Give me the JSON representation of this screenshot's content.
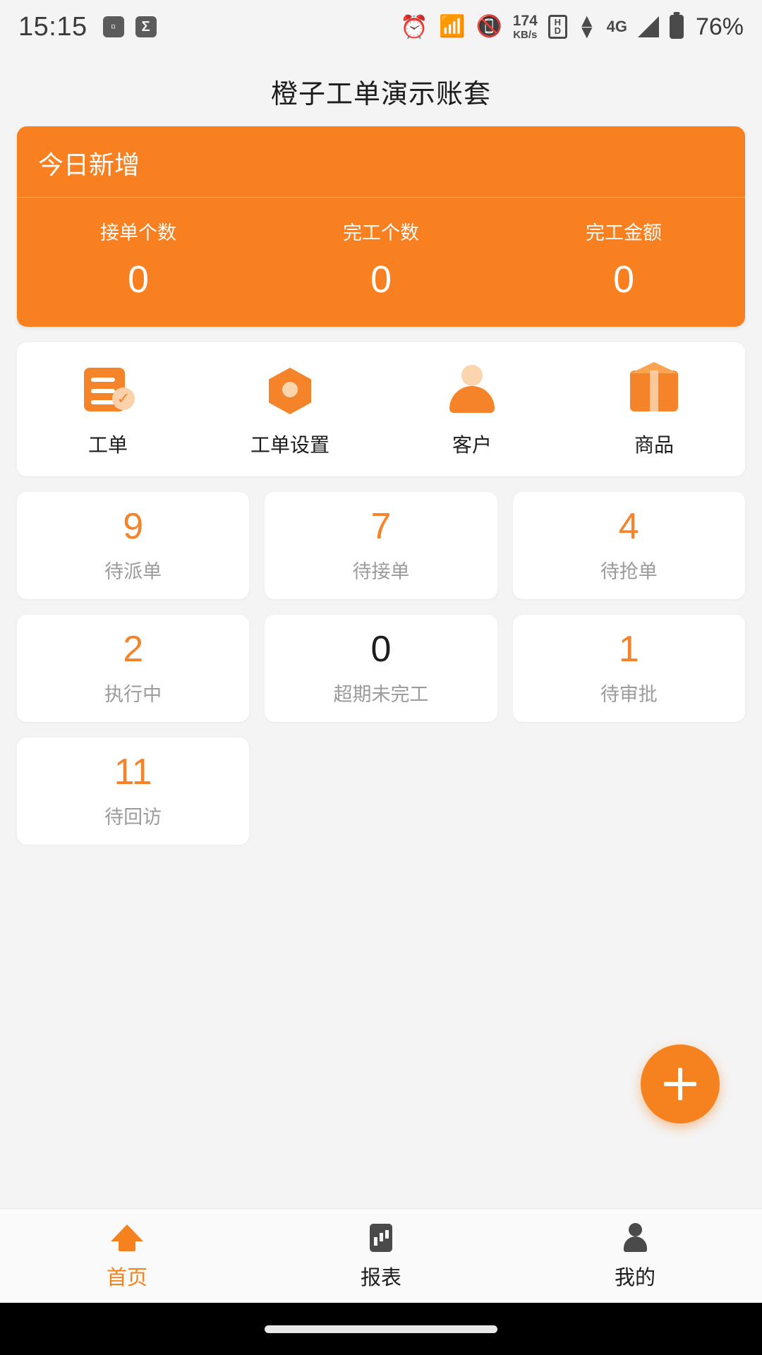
{
  "status_bar": {
    "time": "15:15",
    "left_icons": [
      "sim-card-icon",
      "sigma-app-icon"
    ],
    "alarm_icon": "alarm-icon",
    "bluetooth_icon": "bluetooth-icon",
    "vibrate_icon": "vibrate-icon",
    "net_speed_value": "174",
    "net_speed_unit": "KB/s",
    "hd_top": "H",
    "hd_bottom": "D",
    "data_arrows": "data-transfer-icon",
    "network_type": "4G",
    "signal_icon": "signal-icon",
    "battery_icon": "battery-icon",
    "battery_percent": "76%"
  },
  "header": {
    "title": "橙子工单演示账套"
  },
  "summary": {
    "title": "今日新增",
    "accent_color": "#f98020",
    "cells": [
      {
        "label": "接单个数",
        "value": "0"
      },
      {
        "label": "完工个数",
        "value": "0"
      },
      {
        "label": "完工金额",
        "value": "0"
      }
    ]
  },
  "quick_entries": [
    {
      "label": "工单",
      "icon": "work-order-icon"
    },
    {
      "label": "工单设置",
      "icon": "work-order-settings-icon"
    },
    {
      "label": "客户",
      "icon": "customer-icon"
    },
    {
      "label": "商品",
      "icon": "product-box-icon"
    }
  ],
  "tiles": [
    {
      "value": "9",
      "label": "待派单",
      "highlight": true
    },
    {
      "value": "7",
      "label": "待接单",
      "highlight": true
    },
    {
      "value": "4",
      "label": "待抢单",
      "highlight": true
    },
    {
      "value": "2",
      "label": "执行中",
      "highlight": true
    },
    {
      "value": "0",
      "label": "超期未完工",
      "highlight": false
    },
    {
      "value": "1",
      "label": "待审批",
      "highlight": true
    },
    {
      "value": "11",
      "label": "待回访",
      "highlight": true
    }
  ],
  "fab": {
    "icon": "plus-icon",
    "color": "#f5821f"
  },
  "tabbar": {
    "active_color": "#f5821f",
    "tabs": [
      {
        "label": "首页",
        "icon": "home-icon",
        "active": true
      },
      {
        "label": "报表",
        "icon": "report-icon",
        "active": false
      },
      {
        "label": "我的",
        "icon": "person-icon",
        "active": false
      }
    ]
  }
}
